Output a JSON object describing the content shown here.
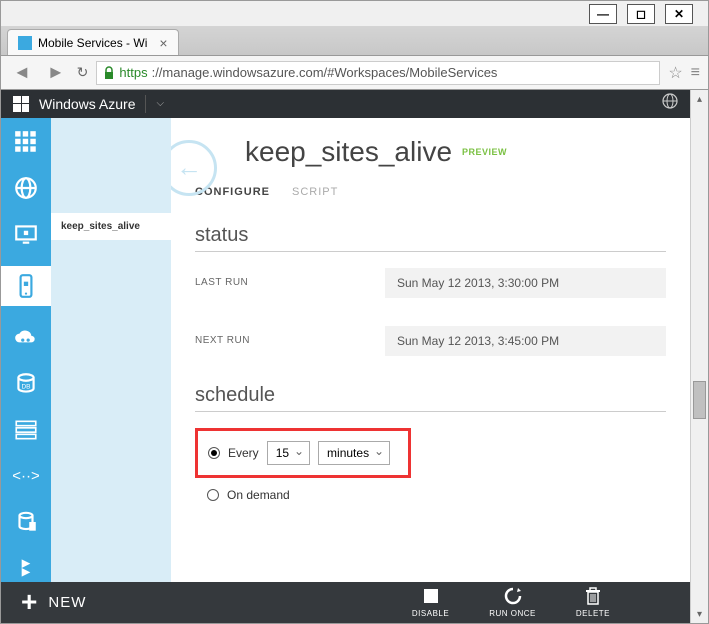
{
  "window": {
    "tab_title": "Mobile Services - Wi",
    "url_proto": "https",
    "url_rest": "://manage.windowsazure.com/#Workspaces/MobileServices"
  },
  "azure": {
    "brand": "Windows Azure"
  },
  "sidebar": {
    "selected_item": "keep_sites_alive"
  },
  "page": {
    "title": "keep_sites_alive",
    "preview": "PREVIEW",
    "tabs": {
      "configure": "CONFIGURE",
      "script": "SCRIPT"
    },
    "status_head": "status",
    "last_run_label": "LAST RUN",
    "last_run_value": "Sun May 12 2013, 3:30:00 PM",
    "next_run_label": "NEXT RUN",
    "next_run_value": "Sun May 12 2013, 3:45:00 PM",
    "schedule_head": "schedule",
    "every_label": "Every",
    "interval": "15",
    "unit": "minutes",
    "on_demand": "On demand"
  },
  "bottom": {
    "new": "NEW",
    "disable": "DISABLE",
    "run_once": "RUN ONCE",
    "delete": "DELETE"
  }
}
